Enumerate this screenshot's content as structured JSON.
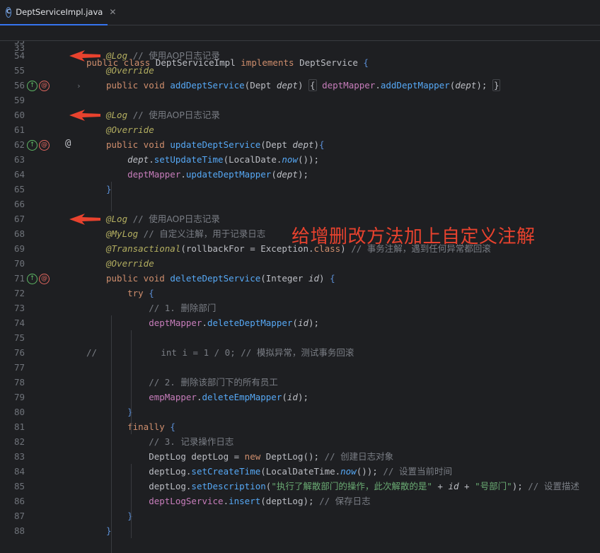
{
  "tab": {
    "icon": "C",
    "filename": "DeptServiceImpl.java",
    "close": "✕"
  },
  "sticky": {
    "line": "33",
    "code": {
      "kw1": "public class ",
      "cls": "DeptServiceImpl ",
      "kw2": "implements ",
      "iface": "DeptService ",
      "brace": "{"
    }
  },
  "cut_line": "53",
  "gutter": {
    "impl_icon": "implements-icon",
    "aop_icon": "aop-advice-icon",
    "at_symbol": "@",
    "fold": "›"
  },
  "overlay_note": "给增删改方法加上自定义注解",
  "lines": [
    {
      "n": "54",
      "parts": [
        [
          "ann",
          "@Log"
        ],
        [
          "cm",
          " // "
        ],
        [
          "cmzh",
          "使用AOP日志记录"
        ]
      ]
    },
    {
      "n": "55",
      "parts": [
        [
          "ann",
          "@Override"
        ]
      ]
    },
    {
      "n": "56",
      "parts": [
        [
          "kw",
          "public void "
        ],
        [
          "fn",
          "addDeptService"
        ],
        [
          "cls",
          "(Dept "
        ],
        [
          "param",
          "dept"
        ],
        [
          "cls",
          ") "
        ],
        [
          "fold",
          "{"
        ],
        [
          "cls",
          " "
        ],
        [
          "field",
          "deptMapper"
        ],
        [
          "cls",
          "."
        ],
        [
          "mcall",
          "addDeptMapper"
        ],
        [
          "cls",
          "("
        ],
        [
          "param",
          "dept"
        ],
        [
          "cls",
          ");"
        ],
        [
          "cls",
          " "
        ],
        [
          "fold",
          "}"
        ]
      ]
    },
    {
      "n": "59",
      "parts": []
    },
    {
      "n": "60",
      "parts": [
        [
          "ann",
          "@Log"
        ],
        [
          "cm",
          " // "
        ],
        [
          "cmzh",
          "使用AOP日志记录"
        ]
      ]
    },
    {
      "n": "61",
      "parts": [
        [
          "ann",
          "@Override"
        ]
      ]
    },
    {
      "n": "62",
      "parts": [
        [
          "kw",
          "public void "
        ],
        [
          "fn",
          "updateDeptService"
        ],
        [
          "cls",
          "(Dept "
        ],
        [
          "param",
          "dept"
        ],
        [
          "cls",
          ")"
        ],
        [
          "brace-hl",
          "{"
        ]
      ]
    },
    {
      "n": "63",
      "parts": [
        [
          "param",
          "    dept"
        ],
        [
          "cls",
          "."
        ],
        [
          "mcall",
          "setUpdateTime"
        ],
        [
          "cls",
          "(LocalDate."
        ],
        [
          "smeth",
          "now"
        ],
        [
          "cls",
          "());"
        ]
      ]
    },
    {
      "n": "64",
      "parts": [
        [
          "field",
          "    deptMapper"
        ],
        [
          "cls",
          "."
        ],
        [
          "mcall",
          "updateDeptMapper"
        ],
        [
          "cls",
          "("
        ],
        [
          "param",
          "dept"
        ],
        [
          "cls",
          ");"
        ]
      ]
    },
    {
      "n": "65",
      "parts": [
        [
          "brace-hl",
          "}"
        ]
      ]
    },
    {
      "n": "66",
      "parts": []
    },
    {
      "n": "67",
      "parts": [
        [
          "ann",
          "@Log"
        ],
        [
          "cm",
          " // "
        ],
        [
          "cmzh",
          "使用AOP日志记录"
        ]
      ]
    },
    {
      "n": "68",
      "parts": [
        [
          "ann",
          "@MyLog"
        ],
        [
          "cm",
          " // "
        ],
        [
          "cmzh",
          "自定义注解，用于记录日志"
        ]
      ]
    },
    {
      "n": "69",
      "parts": [
        [
          "ann",
          "@Transactional"
        ],
        [
          "cls",
          "(rollbackFor = Exception."
        ],
        [
          "kw",
          "class"
        ],
        [
          "cls",
          ") "
        ],
        [
          "cm",
          "// "
        ],
        [
          "cmzh",
          "事务注解，遇到任何异常都回滚"
        ]
      ]
    },
    {
      "n": "70",
      "parts": [
        [
          "ann",
          "@Override"
        ]
      ]
    },
    {
      "n": "71",
      "parts": [
        [
          "kw",
          "public void "
        ],
        [
          "fn",
          "deleteDeptService"
        ],
        [
          "cls",
          "(Integer "
        ],
        [
          "param",
          "id"
        ],
        [
          "cls",
          ") "
        ],
        [
          "brace-hl",
          "{"
        ]
      ]
    },
    {
      "n": "72",
      "parts": [
        [
          "kw",
          "    try "
        ],
        [
          "brace-hl",
          "{"
        ]
      ]
    },
    {
      "n": "73",
      "parts": [
        [
          "cm",
          "        // 1. "
        ],
        [
          "cmzh",
          "删除部门"
        ]
      ]
    },
    {
      "n": "74",
      "parts": [
        [
          "field",
          "        deptMapper"
        ],
        [
          "cls",
          "."
        ],
        [
          "mcall",
          "deleteDeptMapper"
        ],
        [
          "cls",
          "("
        ],
        [
          "param",
          "id"
        ],
        [
          "cls",
          ");"
        ]
      ]
    },
    {
      "n": "75",
      "parts": []
    },
    {
      "n": "76",
      "parts": [
        [
          "cm",
          "//            int i = 1 / 0; // "
        ],
        [
          "cmzh",
          "模拟异常，测试事务回滚"
        ]
      ]
    },
    {
      "n": "77",
      "parts": []
    },
    {
      "n": "78",
      "parts": [
        [
          "cm",
          "        // 2. "
        ],
        [
          "cmzh",
          "删除该部门下的所有员工"
        ]
      ]
    },
    {
      "n": "79",
      "parts": [
        [
          "field",
          "        empMapper"
        ],
        [
          "cls",
          "."
        ],
        [
          "mcall",
          "deleteEmpMapper"
        ],
        [
          "cls",
          "("
        ],
        [
          "param",
          "id"
        ],
        [
          "cls",
          ");"
        ]
      ]
    },
    {
      "n": "80",
      "parts": [
        [
          "brace-hl",
          "    }"
        ]
      ]
    },
    {
      "n": "81",
      "parts": [
        [
          "kw",
          "    finally "
        ],
        [
          "brace-hl",
          "{"
        ]
      ]
    },
    {
      "n": "82",
      "parts": [
        [
          "cm",
          "        // 3. "
        ],
        [
          "cmzh",
          "记录操作日志"
        ]
      ]
    },
    {
      "n": "83",
      "parts": [
        [
          "cls",
          "        DeptLog deptLog = "
        ],
        [
          "kw",
          "new "
        ],
        [
          "cls",
          "DeptLog(); "
        ],
        [
          "cm",
          "// "
        ],
        [
          "cmzh",
          "创建日志对象"
        ]
      ]
    },
    {
      "n": "84",
      "parts": [
        [
          "cls",
          "        deptLog."
        ],
        [
          "mcall",
          "setCreateTime"
        ],
        [
          "cls",
          "(LocalDateTime."
        ],
        [
          "smeth",
          "now"
        ],
        [
          "cls",
          "()); "
        ],
        [
          "cm",
          "// "
        ],
        [
          "cmzh",
          "设置当前时间"
        ]
      ]
    },
    {
      "n": "85",
      "parts": [
        [
          "cls",
          "        deptLog."
        ],
        [
          "mcall",
          "setDescription"
        ],
        [
          "cls",
          "("
        ],
        [
          "str",
          "\""
        ],
        [
          "strzh",
          "执行了解散部门的操作，此次解散的是"
        ],
        [
          "str",
          "\""
        ],
        [
          "cls",
          " + "
        ],
        [
          "param",
          "id"
        ],
        [
          "cls",
          " + "
        ],
        [
          "str",
          "\""
        ],
        [
          "strzh",
          "号部门"
        ],
        [
          "str",
          "\""
        ],
        [
          "cls",
          "); "
        ],
        [
          "cm",
          "// "
        ],
        [
          "cmzh",
          "设置描述"
        ]
      ]
    },
    {
      "n": "86",
      "parts": [
        [
          "field",
          "        deptLogService"
        ],
        [
          "cls",
          "."
        ],
        [
          "mcall",
          "insert"
        ],
        [
          "cls",
          "(deptLog); "
        ],
        [
          "cm",
          "// "
        ],
        [
          "cmzh",
          "保存日志"
        ]
      ]
    },
    {
      "n": "87",
      "parts": [
        [
          "brace-hl",
          "    }"
        ]
      ]
    },
    {
      "n": "88",
      "parts": [
        [
          "brace-hl",
          "}"
        ]
      ]
    }
  ]
}
